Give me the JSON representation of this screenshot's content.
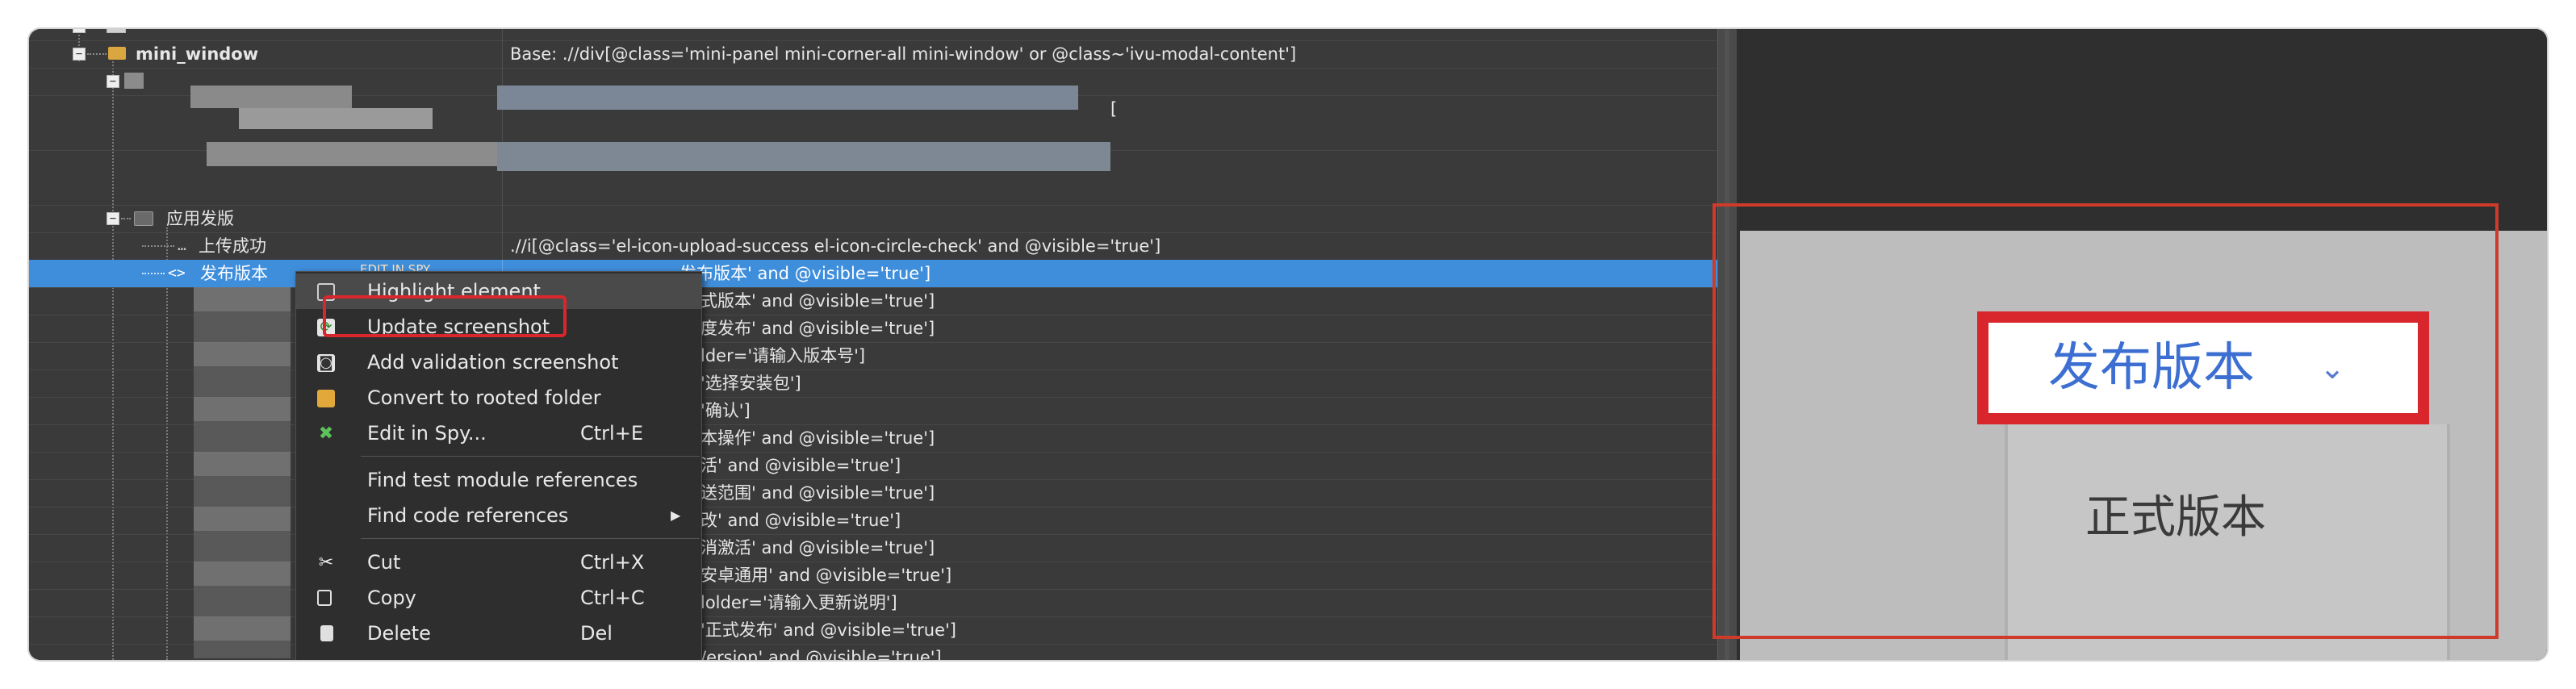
{
  "tree": {
    "rows": [
      {
        "label": "mini_window",
        "value": "Base: .//div[@class='mini-panel mini-corner-all mini-window' or @class~'ivu-modal-content']"
      },
      {
        "label": "",
        "value": ""
      },
      {
        "label": "",
        "value": "["
      },
      {
        "label": "",
        "value": ""
      },
      {
        "label": "应用发版",
        "value": ""
      },
      {
        "label": "上传成功",
        "value": ".//i[@class='el-icon-upload-success el-icon-circle-check' and @visible='true']"
      },
      {
        "label": "发布版本",
        "value": "发布版本' and @visible='true']"
      },
      {
        "label": "",
        "value": "式版本' and @visible='true']"
      },
      {
        "label": "",
        "value": "度发布' and @visible='true']"
      },
      {
        "label": "",
        "value": "lder='请输入版本号']"
      },
      {
        "label": "",
        "value": "'选择安装包']"
      },
      {
        "label": "",
        "value": "'确认']"
      },
      {
        "label": "",
        "value": "本操作' and @visible='true']"
      },
      {
        "label": "",
        "value": "活' and @visible='true']"
      },
      {
        "label": "",
        "value": "送范围' and @visible='true']"
      },
      {
        "label": "",
        "value": "改' and @visible='true']"
      },
      {
        "label": "",
        "value": "消激活' and @visible='true']"
      },
      {
        "label": "",
        "value": "安卓通用' and @visible='true']"
      },
      {
        "label": "",
        "value": "lolder='请输入更新说明']"
      },
      {
        "label": "",
        "value": "'正式发布' and @visible='true']"
      },
      {
        "label": "",
        "value": "/ersion' and @visible='true']"
      }
    ],
    "selected_tag": "EDIT IN SPY"
  },
  "context_menu": {
    "items": [
      {
        "icon": "highlight-icon",
        "label": "Highlight element",
        "shortcut": ""
      },
      {
        "icon": "update-screenshot-icon",
        "label": "Update screenshot",
        "shortcut": ""
      },
      {
        "icon": "validation-screenshot-icon",
        "label": "Add validation screenshot",
        "shortcut": ""
      },
      {
        "icon": "rooted-folder-icon",
        "label": "Convert to rooted folder",
        "shortcut": ""
      },
      {
        "icon": "spy-icon",
        "label": "Edit in Spy...",
        "shortcut": "Ctrl+E"
      },
      {
        "icon": "",
        "label": "Find test module references",
        "shortcut": ""
      },
      {
        "icon": "",
        "label": "Find code references",
        "shortcut": ""
      },
      {
        "icon": "cut-icon",
        "label": "Cut",
        "shortcut": "Ctrl+X"
      },
      {
        "icon": "copy-icon",
        "label": "Copy",
        "shortcut": "Ctrl+C"
      },
      {
        "icon": "delete-icon",
        "label": "Delete",
        "shortcut": "Del"
      }
    ]
  },
  "preview": {
    "dropdown_label": "发布版本",
    "chevron": "⌄",
    "menu_item": "正式版本"
  },
  "colors": {
    "selection": "#3f8edc",
    "highlight_frame": "#d8262c",
    "preview_frame": "#cf3b2a"
  }
}
